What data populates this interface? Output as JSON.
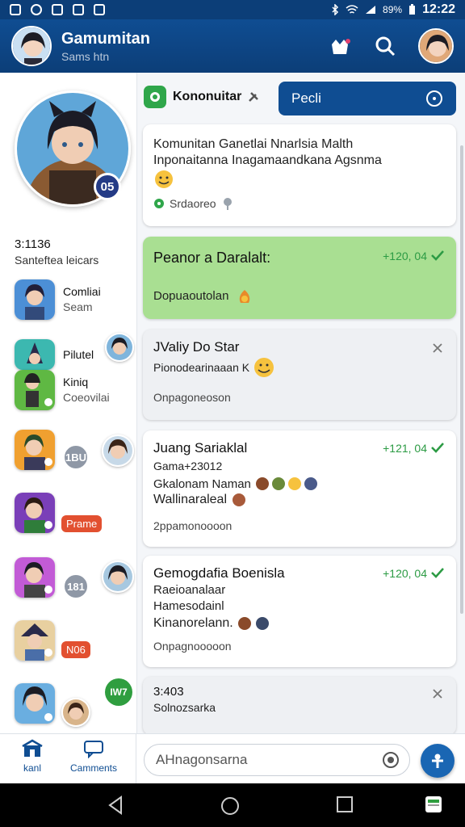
{
  "status_bar": {
    "time": "12:22",
    "battery": "89%"
  },
  "app_bar": {
    "title": "Gamumitan",
    "subtitle": "Sams htn"
  },
  "sidebar": {
    "hero_badge": "05",
    "time": "3:1136",
    "label": "Santeftea leicars",
    "items": [
      {
        "name": "Comliai",
        "sub": "Seam"
      },
      {
        "name": "Pilutel",
        "sub": ""
      },
      {
        "name": "Kiniq",
        "sub": "Coeovilai"
      }
    ],
    "badge_1": "1BU",
    "pill_1": "Prame",
    "badge_2": "181",
    "pill_2": "N06",
    "green_badge": "IW7"
  },
  "header": {
    "group_name": "Kononuitar",
    "search_placeholder": "Pecli"
  },
  "cards": [
    {
      "line1": "Komunitan Ganetlai Nnarlsia Malth",
      "line2": "Inponaitanna Inagamaandkana Agsnma",
      "meta": "Srdaoreo"
    },
    {
      "title": "Peanor a Daralalt:",
      "time": "+120, 04",
      "meta": "Dopuaoutolan"
    },
    {
      "title": "JValiy Do Star",
      "sub": "Pionodearinaaan K",
      "meta": "Onpagoneoson"
    },
    {
      "title": "Juang Sariaklal",
      "time": "+121, 04",
      "line1": "Gama+23012",
      "line2": "Gkalonam Naman",
      "line3": "Wallinaraleal",
      "meta": "2ppamonoooon"
    },
    {
      "title": "Gemogdafia Boenisla",
      "time": "+120, 04",
      "line1": "Raeioanalaar",
      "line2": "Hamesodainl",
      "line3": "Kinanorelann.",
      "meta": "Onpagnooooon"
    },
    {
      "title": "3:403",
      "sub": "Solnozsarka"
    }
  ],
  "bottom_nav": {
    "tab_home": "kanl",
    "tab_comments": "Camments",
    "compose_placeholder": "AHnagonsarna"
  },
  "colors": {
    "primary": "#0c3e78",
    "accent_green": "#2f9e3f",
    "green_card": "#a9df92",
    "pill_red": "#e25030"
  }
}
